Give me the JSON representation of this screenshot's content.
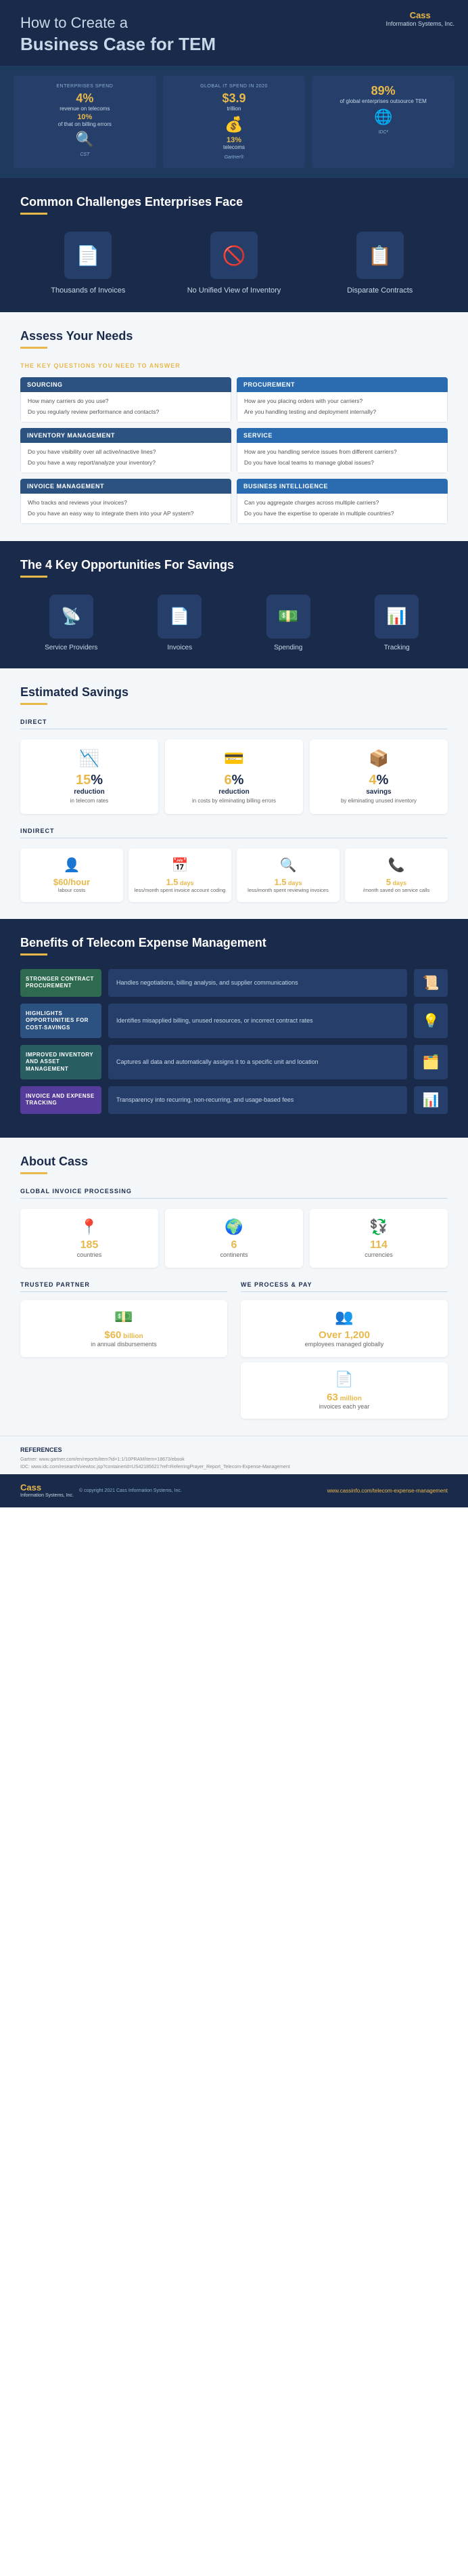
{
  "header": {
    "title_light": "How to Create a",
    "title_bold": "Business Case for TEM",
    "logo_brand": "Cass",
    "logo_sub": "Information\nSystems, Inc."
  },
  "stats": [
    {
      "source_label": "ENTERPRISES SPEND",
      "accent": "4%",
      "desc1": "revenue on telecoms",
      "sub": "10%",
      "desc2": "of that on billing errors",
      "icon": "🔍",
      "source": "CST"
    },
    {
      "source_label": "GLOBAL IT SPEND IN 2020",
      "accent": "$3.9",
      "desc1": "trillion",
      "sub": "13%",
      "desc2": "telecoms",
      "icon": "💰",
      "source": "Gartner®"
    },
    {
      "source_label": "",
      "accent": "89%",
      "desc1": "of global enterprises outsource TEM",
      "sub": "",
      "desc2": "",
      "icon": "🌐",
      "source": "IDC²"
    }
  ],
  "challenges": {
    "title": "Common Challenges Enterprises Face",
    "items": [
      {
        "label": "Thousands of Invoices",
        "icon": "📄"
      },
      {
        "label": "No Unified View of Inventory",
        "icon": "🚫"
      },
      {
        "label": "Disparate Contracts",
        "icon": "📋"
      }
    ]
  },
  "assess": {
    "title": "Assess Your Needs",
    "subtitle": "THE KEY QUESTIONS YOU NEED TO ANSWER",
    "cards": [
      {
        "header": "SOURCING",
        "color": "blue",
        "questions": [
          "How many carriers do you use?",
          "Do you regularly review performance and contacts?"
        ]
      },
      {
        "header": "PROCUREMENT",
        "color": "teal",
        "questions": [
          "How are you placing orders with your carriers?",
          "Are you handling testing and deployment internally?"
        ]
      },
      {
        "header": "INVENTORY MANAGEMENT",
        "color": "blue",
        "questions": [
          "Do you have visibility over all active/inactive lines?",
          "Do you have a way report/analyze your inventory?"
        ]
      },
      {
        "header": "SERVICE",
        "color": "teal",
        "questions": [
          "How are you handling service issues from different carriers?",
          "Do you have local teams to manage global issues?"
        ]
      },
      {
        "header": "INVOICE MANAGEMENT",
        "color": "blue",
        "questions": [
          "Who tracks and reviews your invoices?",
          "Do you have an easy way to integrate them into your AP system?"
        ]
      },
      {
        "header": "BUSINESS INTELLIGENCE",
        "color": "teal",
        "questions": [
          "Can you aggregate charges across multiple carriers?",
          "Do you have the expertise to operate in multiple countries?"
        ]
      }
    ]
  },
  "opportunities": {
    "title": "The 4 Key Opportunities For Savings",
    "items": [
      {
        "label": "Service Providers",
        "icon": "📡"
      },
      {
        "label": "Invoices",
        "icon": "📄"
      },
      {
        "label": "Spending",
        "icon": "💵"
      },
      {
        "label": "Tracking",
        "icon": "📊"
      }
    ]
  },
  "savings": {
    "title": "Estimated Savings",
    "direct_label": "DIRECT",
    "indirect_label": "INDIRECT",
    "direct_items": [
      {
        "icon": "📉",
        "pct": "15",
        "type": "reduction",
        "desc": "in telecom rates"
      },
      {
        "icon": "💳",
        "pct": "6",
        "type": "reduction",
        "desc": "in costs by eliminating billing errors"
      },
      {
        "icon": "📦",
        "pct": "4",
        "type": "savings",
        "desc": "by eliminating unused inventory"
      }
    ],
    "indirect_items": [
      {
        "icon": "👤",
        "val": "$60",
        "unit": "/hour",
        "desc": "labour costs"
      },
      {
        "icon": "📅",
        "val": "1.5",
        "unit": " days",
        "desc": "less/month spent invoice account coding"
      },
      {
        "icon": "🔍",
        "val": "1.5",
        "unit": " days",
        "desc": "less/month spent reviewing invoices"
      },
      {
        "icon": "📞",
        "val": "5",
        "unit": " days",
        "desc": "/month saved on service calls"
      }
    ]
  },
  "benefits": {
    "title": "Benefits of Telecom Expense Management",
    "items": [
      {
        "label": "STRONGER CONTRACT PROCUREMENT",
        "color": "green",
        "desc": "Handles negotiations, billing analysis, and supplier communications",
        "icon": "📜"
      },
      {
        "label": "HIGHLIGHTS OPPORTUNITIES FOR COST-SAVINGS",
        "color": "blue",
        "desc": "Identifies misapplied billing, unused resources, or incorrect contract rates",
        "icon": "💡"
      },
      {
        "label": "IMPROVED INVENTORY AND ASSET MANAGEMENT",
        "color": "teal",
        "desc": "Captures all data and automatically assigns it to a specific unit and location",
        "icon": "🗂️"
      },
      {
        "label": "INVOICE AND EXPENSE TRACKING",
        "color": "purple",
        "desc": "Transparency into recurring, non-recurring, and usage-based fees",
        "icon": "📊"
      }
    ]
  },
  "about": {
    "title": "About Cass",
    "global_label": "GLOBAL INVOICE PROCESSING",
    "global_items": [
      {
        "icon": "📍",
        "val": "185",
        "unit": "",
        "desc": "countries"
      },
      {
        "icon": "🌍",
        "val": "6",
        "unit": "",
        "desc": "continents"
      },
      {
        "icon": "💱",
        "val": "114",
        "unit": "",
        "desc": "currencies"
      }
    ],
    "trusted_label": "TRUSTED PARTNER",
    "wepay_label": "WE PROCESS & PAY",
    "trusted_items": [
      {
        "icon": "💵",
        "val": "$60",
        "unit": " billion",
        "desc": "in annual disbursements"
      },
      {
        "icon": "👥",
        "val": "Over 1,200",
        "unit": "",
        "desc": "employees managed globally"
      },
      {
        "icon": "📄",
        "val": "63",
        "unit": " million",
        "desc": "invoices each year"
      }
    ]
  },
  "footer": {
    "refs_title": "REFERENCES",
    "ref1": "Gartner: www.gartner.com/en/reports/item?id=1:1/10PRAM/item=18673/ebook",
    "ref2": "IDC: www.idc.com/research/viewtoc.jsp?containerId=US42185621?ref=ReferringPrayer_Report_Telecom-Expense-Management",
    "copyright": "© copyright 2021 Cass Information Systems, Inc.",
    "url": "www.cassinfo.com/telecom-expense-management",
    "logo_cass": "Cass",
    "logo_sub": "Information\nSystems, Inc."
  }
}
